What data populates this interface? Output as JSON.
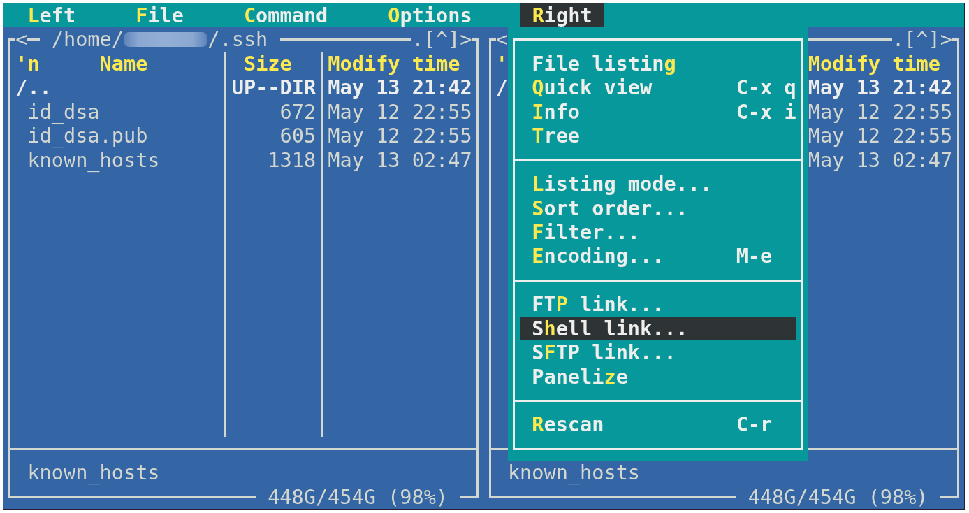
{
  "menu_bar": [
    {
      "label": {
        "key": "L",
        "post": "eft"
      },
      "selected": false
    },
    {
      "label": {
        "key": "F",
        "post": "ile"
      },
      "selected": false
    },
    {
      "label": {
        "key": "C",
        "post": "ommand"
      },
      "selected": false
    },
    {
      "label": {
        "key": "O",
        "post": "ptions"
      },
      "selected": false
    },
    {
      "label": {
        "key": "R",
        "post": "ight"
      },
      "selected": true
    }
  ],
  "panels": [
    {
      "history_button": "<",
      "path": {
        "prefix": "/home/",
        "redacted": true,
        "suffix": "/.ssh"
      },
      "controls": ".[^]>",
      "columns": [
        {
          "kind": "sort",
          "label": "'n"
        },
        {
          "kind": "name",
          "label": "Name"
        },
        {
          "kind": "size",
          "label": "Size"
        },
        {
          "kind": "mtime",
          "label": "Modify time"
        }
      ],
      "rows": [
        {
          "kind": "dir",
          "name": "/..",
          "size": "UP--DIR",
          "mtime": "May 13 21:42"
        },
        {
          "kind": "file",
          "name": "id_dsa",
          "size": "672",
          "mtime": "May 12 22:55"
        },
        {
          "kind": "file",
          "name": "id_dsa.pub",
          "size": "605",
          "mtime": "May 12 22:55"
        },
        {
          "kind": "file",
          "name": "known_hosts",
          "size": "1318",
          "mtime": "May 13 02:47"
        }
      ],
      "mini_status": "known_hosts",
      "disk_usage": "448G/454G (98%)"
    },
    {
      "history_button": "<",
      "controls": ".[^]>",
      "columns": [
        {
          "kind": "sort",
          "label": "'"
        },
        {
          "kind": "mtime",
          "label": "Modify time"
        }
      ],
      "rows": [
        {
          "kind": "dir",
          "name": "/",
          "mtime": "May 13 21:42"
        },
        {
          "kind": "file",
          "mtime": "May 12 22:55"
        },
        {
          "kind": "file",
          "mtime": "May 12 22:55"
        },
        {
          "kind": "file",
          "mtime": "May 13 02:47"
        }
      ],
      "mini_status": "known_hosts",
      "disk_usage": "448G/454G (98%)"
    }
  ],
  "dropdown_menu": {
    "groups": [
      {
        "items": [
          {
            "label": {
              "pre": "File listin",
              "key": "g"
            },
            "selected": false
          },
          {
            "label": {
              "key": "Q",
              "post": "uick view"
            },
            "shortcut": "C-x q",
            "selected": false
          },
          {
            "label": {
              "key": "I",
              "post": "nfo"
            },
            "shortcut": "C-x i",
            "selected": false
          },
          {
            "label": {
              "key": "T",
              "post": "ree"
            },
            "selected": false
          }
        ]
      },
      {
        "items": [
          {
            "label": {
              "key": "L",
              "post": "isting mode..."
            },
            "selected": false
          },
          {
            "label": {
              "key": "S",
              "post": "ort order..."
            },
            "selected": false
          },
          {
            "label": {
              "key": "F",
              "post": "ilter..."
            },
            "selected": false
          },
          {
            "label": {
              "key": "E",
              "post": "ncoding..."
            },
            "shortcut": "M-e",
            "selected": false
          }
        ]
      },
      {
        "items": [
          {
            "label": {
              "pre": "FT",
              "key": "P",
              "post": " link..."
            },
            "selected": false
          },
          {
            "label": {
              "pre": "S",
              "key": "h",
              "post": "ell link..."
            },
            "selected": true
          },
          {
            "label": {
              "pre": "S",
              "key": "F",
              "post": "TP link..."
            },
            "selected": false
          },
          {
            "label": {
              "pre": "Paneli",
              "key": "z",
              "post": "e"
            },
            "selected": false
          }
        ]
      },
      {
        "items": [
          {
            "label": {
              "key": "R",
              "post": "escan"
            },
            "shortcut": "C-r",
            "selected": false
          }
        ]
      }
    ]
  }
}
